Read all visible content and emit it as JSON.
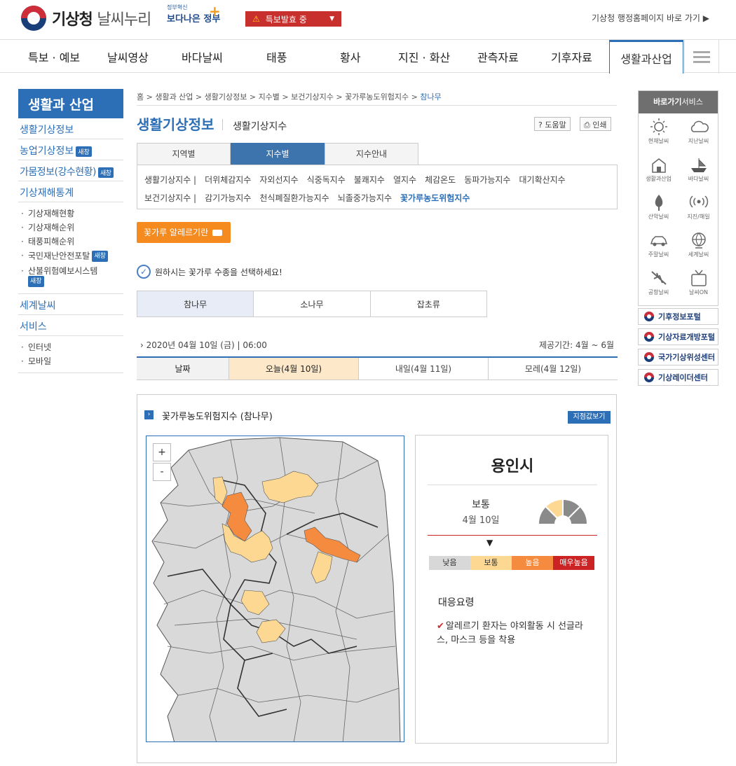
{
  "header": {
    "logo_main": "기상청",
    "logo_sub": "날씨누리",
    "gov_small": "정부혁신",
    "gov_big": "보다나은 정부",
    "alert_label": "특보발효 중",
    "homepage_link": "기상청 행정홈페이지 바로 가기 ▶"
  },
  "gnb": {
    "items": [
      "특보 · 예보",
      "날씨영상",
      "바다날씨",
      "태풍",
      "황사",
      "지진 · 화산",
      "관측자료",
      "기후자료"
    ],
    "active": "생활과산업"
  },
  "lnb": {
    "title": "생활과 산업",
    "items": [
      "생활기상정보",
      "농업기상정보",
      "가뭄정보(강수현황)",
      "기상재해통계"
    ],
    "new_badge": "새창",
    "subitems": [
      "기상재해현황",
      "기상재해순위",
      "태풍피해순위",
      "국민재난안전포탈",
      "산불위험예보시스템"
    ],
    "items2": [
      "세계날씨",
      "서비스"
    ],
    "subitems2": [
      "인터넷",
      "모바일"
    ]
  },
  "breadcrumb": {
    "path": "홈 > 생활과 산업 > 생활기상정보 > 지수별 > 보건기상지수 > 꽃가루농도위험지수 > ",
    "current": "참나무"
  },
  "page": {
    "title": "생활기상정보",
    "subtitle": "생활기상지수",
    "help_label": "도움말",
    "print_label": "인쇄"
  },
  "tabs": [
    "지역별",
    "지수별",
    "지수안내"
  ],
  "index_row1": [
    "생활기상지수 |",
    "더위체감지수",
    "자외선지수",
    "식중독지수",
    "불쾌지수",
    "열지수",
    "체감온도",
    "동파가능지수",
    "대기확산지수"
  ],
  "index_row2": [
    "보건기상지수 |",
    "감기가능지수",
    "천식폐질환가능지수",
    "뇌졸중가능지수",
    "꽃가루농도위험지수"
  ],
  "allergy_button": "꽃가루 알레르기란",
  "select_msg": "원하시는 꽃가루 수종을 선택하세요!",
  "species": [
    "참나무",
    "소나무",
    "잡초류"
  ],
  "datetime": "2020년 04월 10일 (금) | 06:00",
  "period": "제공기간: 4월 ~ 6월",
  "days": {
    "head": "날짜",
    "today": "오늘(4월 10일)",
    "tomorrow": "내일(4월 11일)",
    "dayafter": "모레(4월 12일)"
  },
  "panel": {
    "title": "꽃가루농도위험지수 (참나무)",
    "point_button": "지점값보기",
    "zoom_in": "+",
    "zoom_out": "-"
  },
  "info": {
    "city": "용인시",
    "level": "보통",
    "date": "4월 10일",
    "arrow": "▼",
    "scale": [
      {
        "label": "낮음",
        "color": "#d8d8d8"
      },
      {
        "label": "보통",
        "color": "#fdd892"
      },
      {
        "label": "높음",
        "color": "#f58b3f"
      },
      {
        "label": "매우높음",
        "color": "#cc2424"
      }
    ],
    "guide_title": "대응요령",
    "guide_text": "알레르기 환자는 야외활동 시 선글라스, 마스크 등을 착용"
  },
  "quick": {
    "title_bold": "바로가기",
    "title_rest": "서비스",
    "items": [
      "현재날씨",
      "지난날씨",
      "생활과산업",
      "바다날씨",
      "산악날씨",
      "지진/해일",
      "주말날씨",
      "세계날씨",
      "공항날씨",
      "날씨ON"
    ],
    "portals": [
      "기후정보포털",
      "기상자료개방포털",
      "국가기상위성센터",
      "기상레이더센터"
    ]
  },
  "colors": {
    "primary": "#2d6fb6",
    "alert": "#c7302c",
    "orange": "#f58b1f",
    "map_low": "#d9d9d9",
    "map_normal": "#fdd892",
    "map_high": "#f58b3f"
  }
}
